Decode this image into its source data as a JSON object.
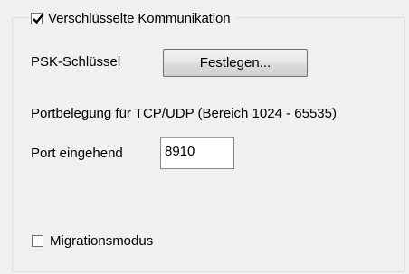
{
  "encryption": {
    "label": "Verschlüsselte Kommunikation",
    "checked": true
  },
  "psk": {
    "label": "PSK-Schlüssel",
    "button_label": "Festlegen..."
  },
  "port_info": {
    "label": "Portbelegung für TCP/UDP (Bereich 1024 - 65535)"
  },
  "port_incoming": {
    "label": "Port eingehend",
    "value": "8910"
  },
  "migration": {
    "label": "Migrationsmodus",
    "checked": false
  },
  "icons": {
    "checkmark": "check-icon"
  }
}
